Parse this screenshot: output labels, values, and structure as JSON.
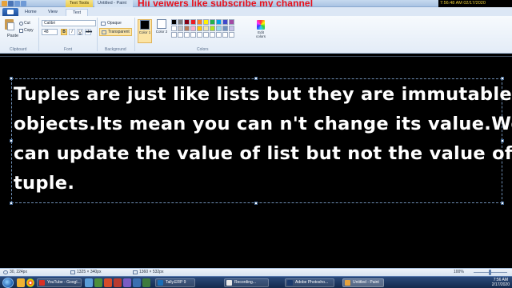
{
  "window": {
    "context_tab": "Text Tools",
    "app_title": "Untitled - Paint",
    "overlay_message": "Hii veiwers like  subscribe my channel",
    "top_clock": "7:56:48 AM 02/17/2020"
  },
  "ribbon_tabs": {
    "home": "Home",
    "view": "View",
    "text": "Text"
  },
  "clipboard": {
    "paste": "Paste",
    "cut": "Cut",
    "copy": "Copy",
    "label": "Clipboard"
  },
  "font": {
    "family": "Calibri",
    "size": "48",
    "bold": "B",
    "italic": "I",
    "underline": "U",
    "label": "Font"
  },
  "background": {
    "opaque": "Opaque",
    "transparent": "Transparent",
    "label": "Background"
  },
  "colors": {
    "color1": "Color 1",
    "color2": "Color 2",
    "edit": "Edit colors",
    "label": "Colors",
    "color1_value": "#000000",
    "color2_value": "#ffffff",
    "palette": [
      "#000000",
      "#7f7f7f",
      "#880015",
      "#ed1c24",
      "#ff7f27",
      "#fff200",
      "#22b14c",
      "#00a2e8",
      "#3f48cc",
      "#a349a4",
      "#ffffff",
      "#c3c3c3",
      "#b97a57",
      "#ffaec9",
      "#ffc90e",
      "#efe4b0",
      "#b5e61d",
      "#99d9ea",
      "#7092be",
      "#c8bfe7",
      "#ffffff",
      "#ffffff",
      "#ffffff",
      "#ffffff",
      "#ffffff",
      "#ffffff",
      "#ffffff",
      "#ffffff",
      "#ffffff",
      "#ffffff"
    ]
  },
  "canvas": {
    "lines": [
      "Tuples are just like lists but they are immutable",
      "objects.Its mean you can n't change its value.We",
      "can update the value of list but not the value of",
      "tuple."
    ]
  },
  "status": {
    "cursor": "30, 224px",
    "selection": "1325 × 340px",
    "canvas_size": "1360 × 532px",
    "zoom": "100%"
  },
  "taskbar": {
    "tasks": [
      {
        "label": "YouTube - Googl...",
        "color": "#d93025"
      },
      {
        "label": "Tally.ERP 9",
        "color": "#1b6fb8"
      },
      {
        "label": "Recording...",
        "color": "#e9e9e9"
      },
      {
        "label": "Adobe Photosho...",
        "color": "#1c3b6e"
      },
      {
        "label": "Untitled - Paint",
        "color": "#e6a23c"
      }
    ],
    "time": "7:56 AM",
    "date": "2/17/2020"
  }
}
